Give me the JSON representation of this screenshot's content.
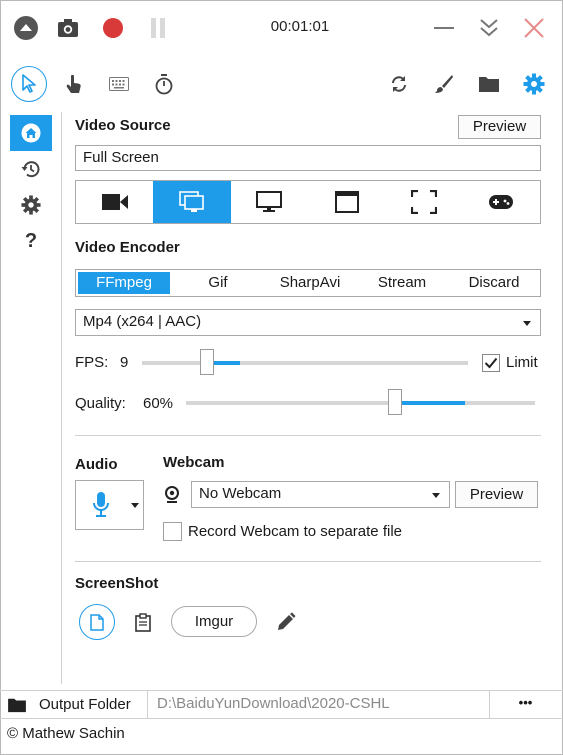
{
  "titlebar": {
    "timer": "00:01:01"
  },
  "video_source": {
    "title": "Video Source",
    "preview_label": "Preview",
    "source_value": "Full Screen"
  },
  "video_encoder": {
    "title": "Video Encoder",
    "tabs": [
      "FFmpeg",
      "Gif",
      "SharpAvi",
      "Stream",
      "Discard"
    ],
    "codec_value": "Mp4 (x264 | AAC)",
    "fps_label": "FPS:",
    "fps_value": "9",
    "limit_label": "Limit",
    "limit_checked": true,
    "quality_label": "Quality:",
    "quality_value": "60%",
    "fps_level": 0.2,
    "quality_level": 0.6
  },
  "audio": {
    "title": "Audio"
  },
  "webcam": {
    "title": "Webcam",
    "selected": "No Webcam",
    "preview_label": "Preview",
    "separate_file_label": "Record Webcam to separate file"
  },
  "screenshot": {
    "title": "ScreenShot",
    "imgur_label": "Imgur"
  },
  "output": {
    "label": "Output Folder",
    "path": "D:\\BaiduYunDownload\\2020-CSHL",
    "more_label": "•••"
  },
  "footer": {
    "copyright": "© Mathew Sachin"
  },
  "colors": {
    "accent": "#1e9be9",
    "record": "#d83a3a",
    "close": "#e88a8a"
  }
}
